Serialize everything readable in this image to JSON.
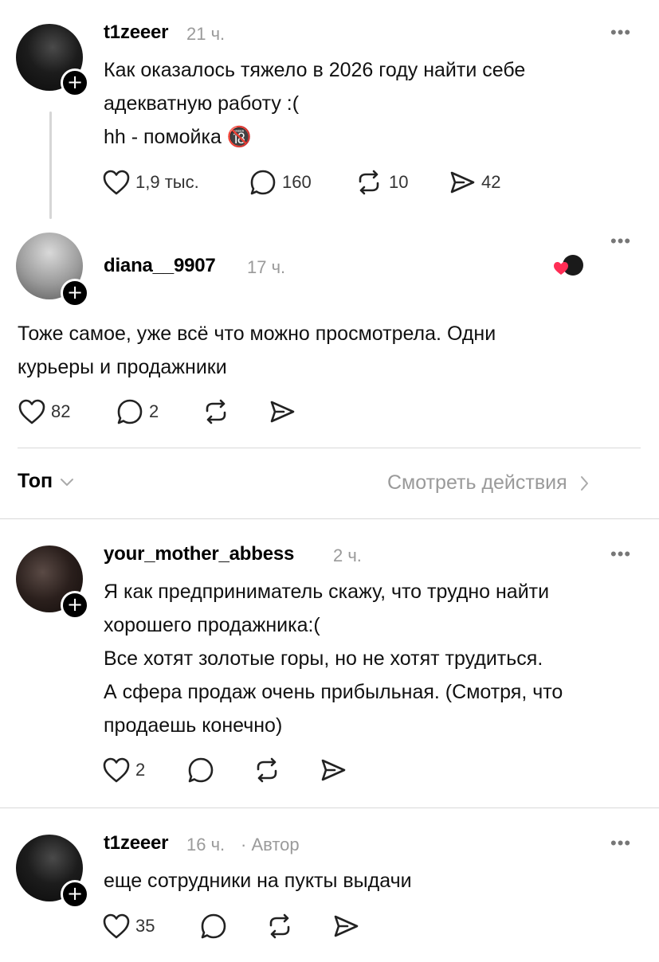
{
  "post": {
    "username": "t1zeeer",
    "time": "21 ч.",
    "lines": [
      "Как оказалось тяжело в 2026 году найти себе",
      "адекватную работу :(",
      "hh - помойка 🔞"
    ],
    "likes": "1,9 тыс.",
    "replies": "160",
    "reposts": "10",
    "shares": "42"
  },
  "reply_main": {
    "username": "diana__9907",
    "time": "17 ч.",
    "lines": [
      "Тоже самое, уже всё что можно  просмотрела. Одни",
      "курьеры и продажники"
    ],
    "likes": "82",
    "replies": "2"
  },
  "filter": {
    "sort_label": "Топ",
    "activity_label": "Смотреть действия"
  },
  "comments": [
    {
      "username": "your_mother_abbess",
      "time": "2 ч.",
      "lines": [
        "Я как предприниматель скажу, что трудно найти",
        "хорошего продажника:(",
        "Все хотят золотые горы, но не хотят трудиться.",
        "А сфера продаж очень прибыльная. (Смотря, что",
        "продаешь конечно)"
      ],
      "likes": "2"
    },
    {
      "username": "t1zeeer",
      "time": "16 ч.",
      "author_tag": "· Автор",
      "lines": [
        "еще сотрудники на пукты выдачи"
      ],
      "likes": "35"
    }
  ],
  "icons": [
    "heart-icon",
    "comment-icon",
    "repost-icon",
    "share-icon",
    "more-icon",
    "chevron-down-icon",
    "chevron-right-icon",
    "plus-icon"
  ]
}
